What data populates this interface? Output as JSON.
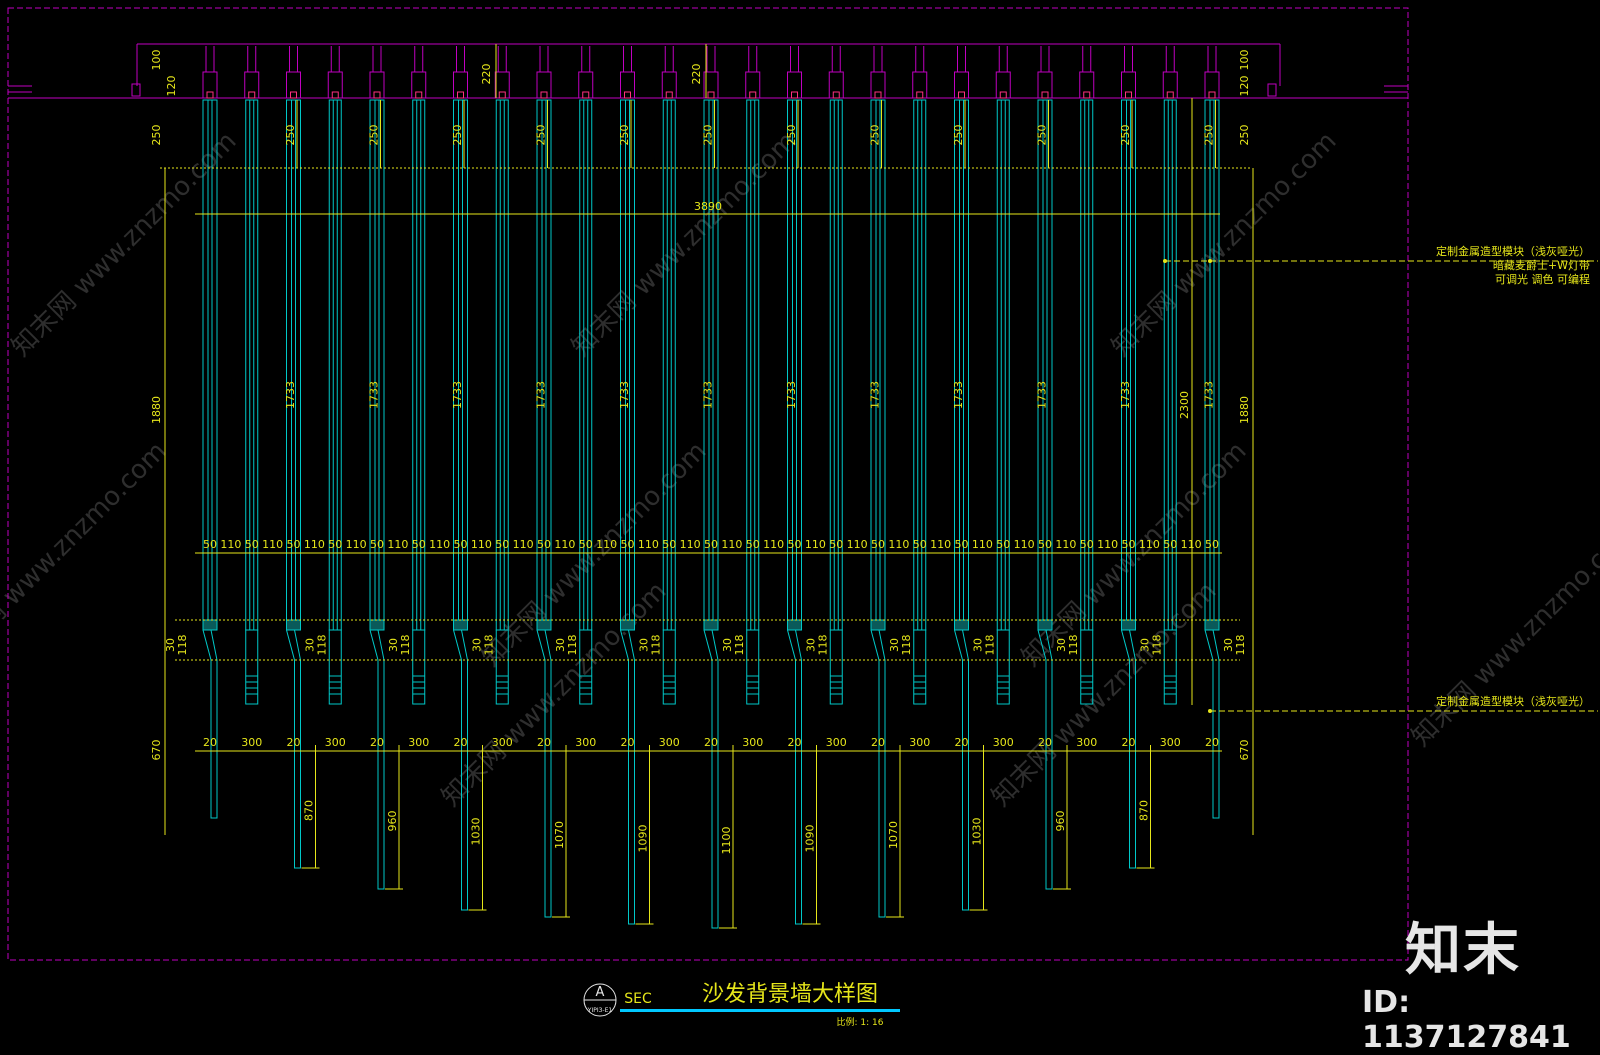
{
  "colors": {
    "background": "#000000",
    "border": "#c000c0",
    "dimension": "#e6e61a",
    "slat": "#00c8c8",
    "note": "#e6e61a",
    "watermark": "#555555",
    "brand": "#e6e6e6",
    "title_underline": "#00c8ff"
  },
  "watermark": "知末网 www.znzmo.com",
  "brand": {
    "logo": "知末",
    "id": "ID: 1137127841"
  },
  "title": {
    "marker_letter": "A",
    "marker_sub": "YIPI3-E1",
    "sec": "SEC",
    "main": "沙发背景墙大样图",
    "scale": "比例: 1: 16"
  },
  "notes": [
    {
      "lines": [
        "定制金属造型模块（浅灰哑光）",
        "暗藏麦爵士+W灯带",
        "可调光 调色 可编程"
      ]
    },
    {
      "lines": [
        "定制金属造型模块（浅灰哑光）"
      ]
    }
  ],
  "dimensions": {
    "top_left_100": "100",
    "top_left_120": "120",
    "top_right_100": "100",
    "top_right_120": "120",
    "top_center_a": "220",
    "top_center_b": "220",
    "row_250": "250",
    "row_1733": "1733",
    "total_width": "3890",
    "left_1880": "1880",
    "right_1880": "1880",
    "right_2300": "2300",
    "left_670": "670",
    "right_670": "670",
    "gap_50": "50",
    "gap_110": "110",
    "gap_30": "30",
    "gap_118": "118",
    "spacing_20": "20",
    "spacing_300": "300",
    "bottom_lengths": [
      "870",
      "960",
      "1030",
      "1070",
      "1090",
      "1100",
      "1090",
      "1070",
      "1030",
      "960",
      "870"
    ]
  }
}
